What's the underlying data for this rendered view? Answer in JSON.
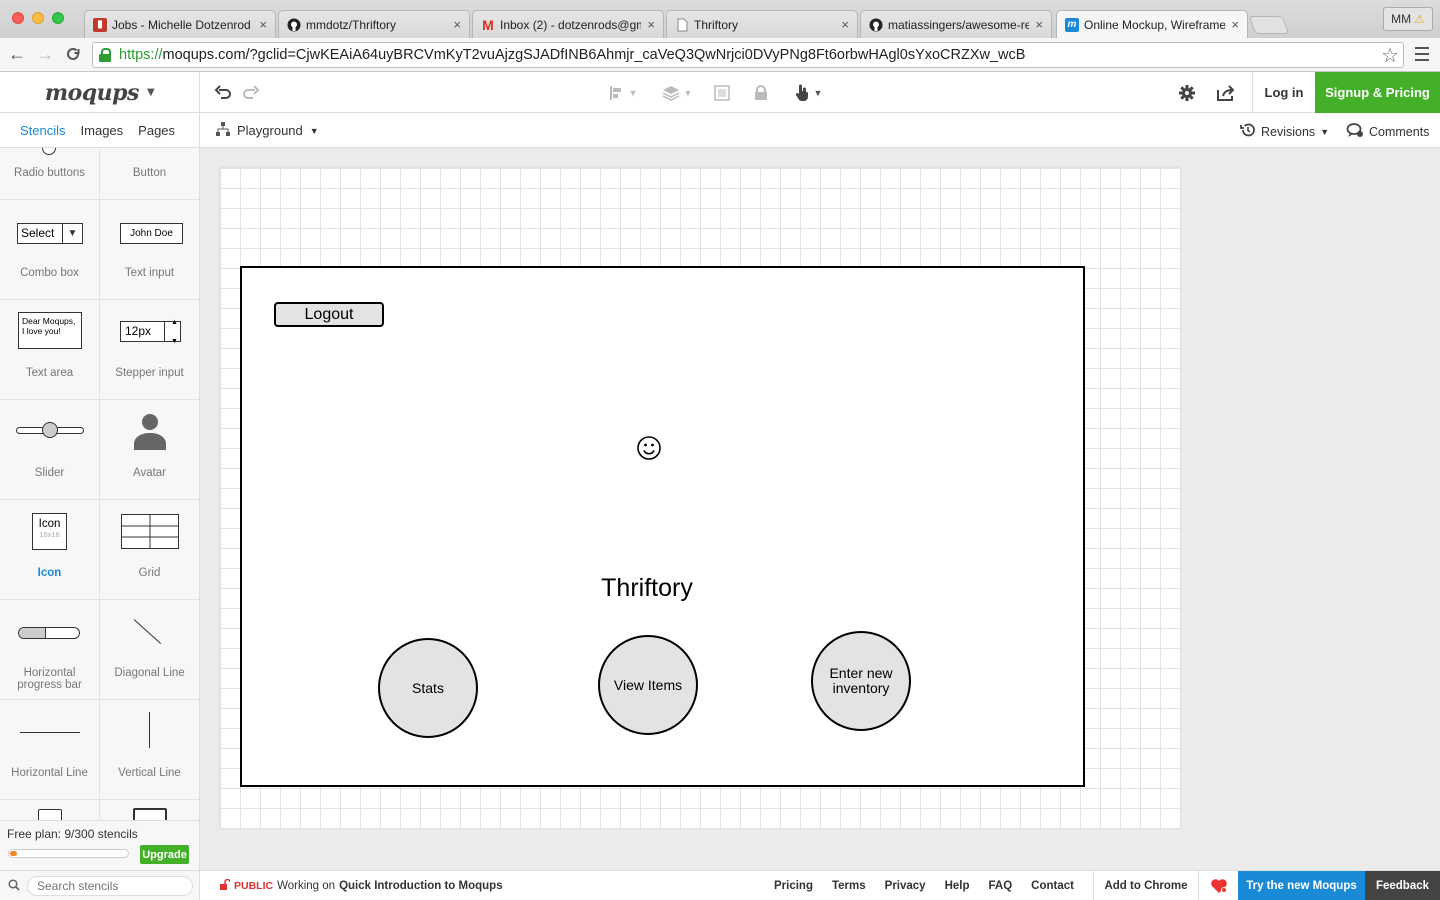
{
  "browser": {
    "tabs": [
      {
        "title": "Jobs - Michelle Dotzenrod",
        "favicon": "trello-icon",
        "color": "#c0392b"
      },
      {
        "title": "mmdotz/Thriftory",
        "favicon": "github-icon",
        "color": "#222222"
      },
      {
        "title": "Inbox (2) - dotzenrods@gm",
        "favicon": "gmail-icon",
        "color": "#d93025"
      },
      {
        "title": "Thriftory",
        "favicon": "document-icon",
        "color": "#888888"
      },
      {
        "title": "matiassingers/awesome-re",
        "favicon": "github-icon",
        "color": "#222222"
      },
      {
        "title": "Online Mockup, Wireframe",
        "favicon": "moqups-icon",
        "color": "#1a8ad6"
      }
    ],
    "profile": "MM",
    "url_scheme": "https://",
    "url_rest": "moqups.com/?gclid=CjwKEAiA64uyBRCVmKyT2vuAjzgSJADfINB6Ahmjr_caVeQ3QwNrjci0DVyPNg8Ft6orbwHAgl0sYxoCRZXw_wcB"
  },
  "app": {
    "logo": "moqups",
    "login": "Log in",
    "signup": "Signup & Pricing",
    "accent": "#1a8ad6",
    "brand_green": "#44b02a"
  },
  "panel_tabs": {
    "stencils": "Stencils",
    "images": "Images",
    "pages": "Pages"
  },
  "page_selector": "Playground",
  "revisions": "Revisions",
  "comments": "Comments",
  "stencils": {
    "radio_buttons": "Radio buttons",
    "button": "Button",
    "combo_box": "Combo box",
    "combo_box_value": "Select",
    "text_input": "Text input",
    "text_input_value": "John Doe",
    "text_area": "Text area",
    "text_area_value": "Dear Moqups, I love you!",
    "stepper_input": "Stepper input",
    "stepper_value": "12px",
    "slider": "Slider",
    "avatar": "Avatar",
    "icon": "Icon",
    "icon_preview": "Icon",
    "icon_size": "16x16",
    "grid": "Grid",
    "horizontal_progress_bar": "Horizontal progress bar",
    "diagonal_line": "Diagonal Line",
    "horizontal_line": "Horizontal Line",
    "vertical_line": "Vertical Line"
  },
  "plan": {
    "text": "Free plan: 9/300 stencils",
    "used": 9,
    "total": 300,
    "upgrade": "Upgrade"
  },
  "search": {
    "placeholder": "Search stencils"
  },
  "mockup": {
    "logout": "Logout",
    "title": "Thriftory",
    "buttons": {
      "stats": "Stats",
      "view_items": "View Items",
      "enter_inventory": "Enter new inventory"
    }
  },
  "footer": {
    "public": "PUBLIC",
    "working_on": "Working on",
    "project": "Quick Introduction to Moqups",
    "links": [
      "Pricing",
      "Terms",
      "Privacy",
      "Help",
      "FAQ",
      "Contact"
    ],
    "add_to_chrome": "Add to Chrome",
    "try_new": "Try the new Moqups",
    "feedback": "Feedback"
  }
}
